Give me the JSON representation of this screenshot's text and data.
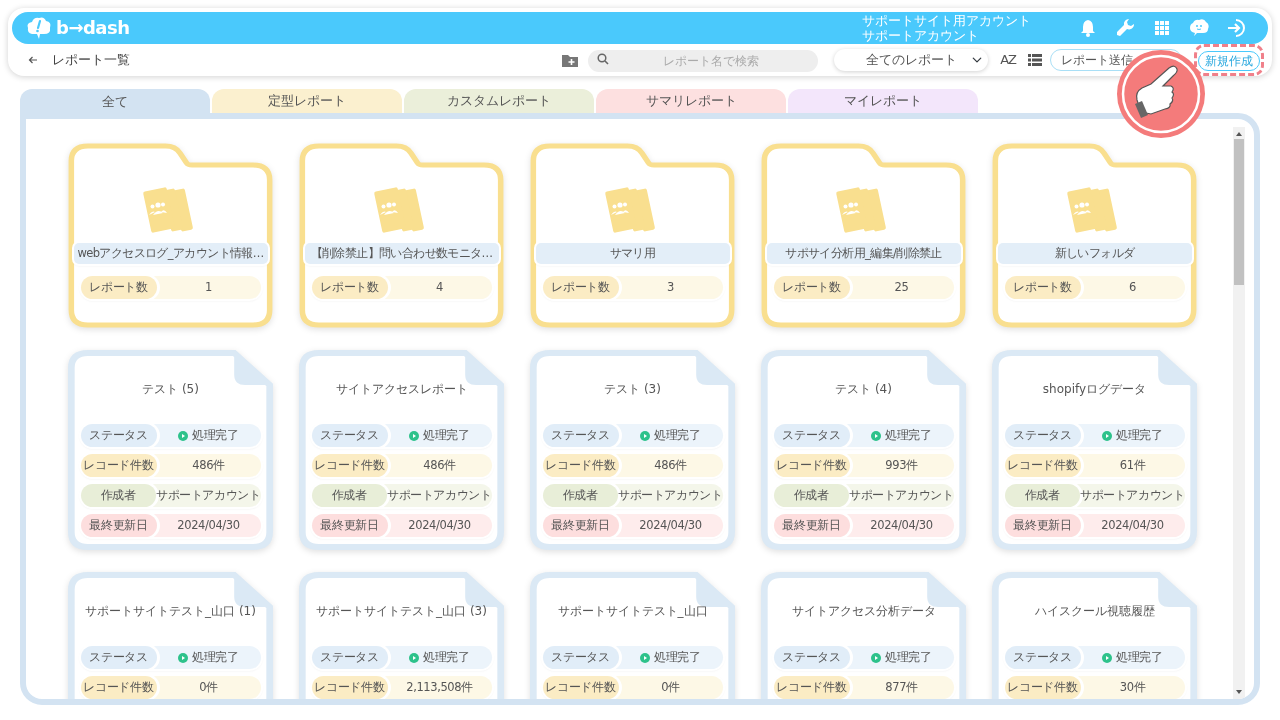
{
  "header": {
    "logo": "b→dash",
    "account_site": "サポートサイト用アカウント",
    "account_user": "サポートアカウント"
  },
  "toolbar": {
    "title": "レポート一覧",
    "search": {
      "placeholder": "レポート名で検索"
    },
    "filter": "全てのレポート",
    "sort": "AZ",
    "send_button": "レポート送信",
    "new_button": "新規作成",
    "new_highlighted": true
  },
  "tabs": [
    {
      "label": "全て",
      "selected": true,
      "color": "#d3e3f2"
    },
    {
      "label": "定型レポート",
      "selected": false,
      "color": "#fbf0cf"
    },
    {
      "label": "カスタムレポート",
      "selected": false,
      "color": "#ebefda"
    },
    {
      "label": "サマリレポート",
      "selected": false,
      "color": "#fde0e0"
    },
    {
      "label": "マイレポート",
      "selected": false,
      "color": "#f3e6fb"
    }
  ],
  "folders": [
    {
      "name": "webアクセスログ_アカウント情報…",
      "count_label": "レポート数",
      "count": "1"
    },
    {
      "name": "【削除禁止】問い合わせ数モニタ…",
      "count_label": "レポート数",
      "count": "4"
    },
    {
      "name": "サマリ用",
      "count_label": "レポート数",
      "count": "3"
    },
    {
      "name": "サポサイ分析用_編集/削除禁止",
      "count_label": "レポート数",
      "count": "25"
    },
    {
      "name": "新しいフォルダ",
      "count_label": "レポート数",
      "count": "6"
    }
  ],
  "reports": [
    {
      "title": "テスト (5)",
      "fields": [
        {
          "kind": "status",
          "label": "ステータス",
          "value": "処理完了"
        },
        {
          "kind": "records",
          "label": "レコード件数",
          "value": "486件"
        },
        {
          "kind": "author",
          "label": "作成者",
          "value": "サポートアカウント"
        },
        {
          "kind": "updated",
          "label": "最終更新日",
          "value": "2024/04/30"
        }
      ]
    },
    {
      "title": "サイトアクセスレポート",
      "fields": [
        {
          "kind": "status",
          "label": "ステータス",
          "value": "処理完了"
        },
        {
          "kind": "records",
          "label": "レコード件数",
          "value": "486件"
        },
        {
          "kind": "author",
          "label": "作成者",
          "value": "サポートアカウント"
        },
        {
          "kind": "updated",
          "label": "最終更新日",
          "value": "2024/04/30"
        }
      ]
    },
    {
      "title": "テスト (3)",
      "fields": [
        {
          "kind": "status",
          "label": "ステータス",
          "value": "処理完了"
        },
        {
          "kind": "records",
          "label": "レコード件数",
          "value": "486件"
        },
        {
          "kind": "author",
          "label": "作成者",
          "value": "サポートアカウント"
        },
        {
          "kind": "updated",
          "label": "最終更新日",
          "value": "2024/04/30"
        }
      ]
    },
    {
      "title": "テスト (4)",
      "fields": [
        {
          "kind": "status",
          "label": "ステータス",
          "value": "処理完了"
        },
        {
          "kind": "records",
          "label": "レコード件数",
          "value": "993件"
        },
        {
          "kind": "author",
          "label": "作成者",
          "value": "サポートアカウント"
        },
        {
          "kind": "updated",
          "label": "最終更新日",
          "value": "2024/04/30"
        }
      ]
    },
    {
      "title": "shopifyログデータ",
      "fields": [
        {
          "kind": "status",
          "label": "ステータス",
          "value": "処理完了"
        },
        {
          "kind": "records",
          "label": "レコード件数",
          "value": "61件"
        },
        {
          "kind": "author",
          "label": "作成者",
          "value": "サポートアカウント"
        },
        {
          "kind": "updated",
          "label": "最終更新日",
          "value": "2024/04/30"
        }
      ]
    },
    {
      "title": "サポートサイトテスト_山口 (1)",
      "fields": [
        {
          "kind": "status",
          "label": "ステータス",
          "value": "処理完了"
        },
        {
          "kind": "records",
          "label": "レコード件数",
          "value": "0件"
        }
      ]
    },
    {
      "title": "サポートサイトテスト_山口 (3)",
      "fields": [
        {
          "kind": "status",
          "label": "ステータス",
          "value": "処理完了"
        },
        {
          "kind": "records",
          "label": "レコード件数",
          "value": "2,113,508件"
        }
      ]
    },
    {
      "title": "サポートサイトテスト_山口",
      "fields": [
        {
          "kind": "status",
          "label": "ステータス",
          "value": "処理完了"
        },
        {
          "kind": "records",
          "label": "レコード件数",
          "value": "0件"
        }
      ]
    },
    {
      "title": "サイトアクセス分析データ",
      "fields": [
        {
          "kind": "status",
          "label": "ステータス",
          "value": "処理完了"
        },
        {
          "kind": "records",
          "label": "レコード件数",
          "value": "877件"
        }
      ]
    },
    {
      "title": "ハイスクール視聴履歴",
      "fields": [
        {
          "kind": "status",
          "label": "ステータス",
          "value": "処理完了"
        },
        {
          "kind": "records",
          "label": "レコード件数",
          "value": "30件"
        }
      ]
    }
  ]
}
